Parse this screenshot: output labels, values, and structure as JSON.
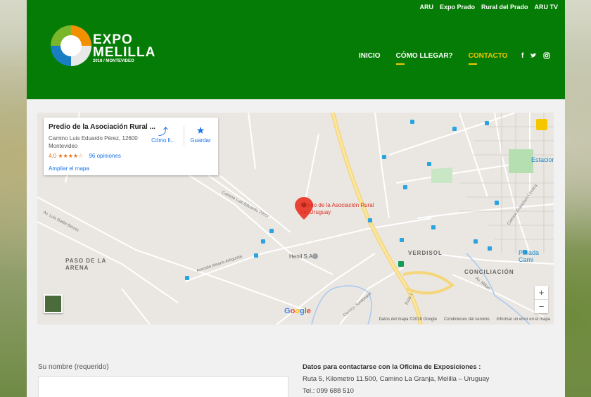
{
  "topnav": [
    "ARU",
    "Expo Prado",
    "Rural del Prado",
    "ARU TV"
  ],
  "logo": {
    "line1": "EXPO",
    "line2": "MELILLA",
    "line3": "2018 / MONTEVIDEO"
  },
  "mainnav": [
    {
      "label": "INICIO",
      "active": false
    },
    {
      "label": "CÓMO LLEGAR?",
      "active": false
    },
    {
      "label": "CONTACTO",
      "active": true
    }
  ],
  "social": [
    "facebook-icon",
    "twitter-icon",
    "instagram-icon"
  ],
  "map": {
    "card": {
      "name": "Predio de la Asociación Rural ...",
      "address": "Camino Luis Eduardo Pérez, 12600 Montevideo",
      "rating": "4.0",
      "stars": "★★★★☆",
      "reviews": "96 opiniones",
      "enlarge": "Ampliar el mapa",
      "directions": "Cómo ll...",
      "save": "Guardar"
    },
    "pin_label": "Predio de la Asociación Rural del Uruguay",
    "places": {
      "henil": "Henil S.A",
      "estacion": "Estacion",
      "parada": "Parada Cami"
    },
    "areas": [
      "PASO DE LA ARENA",
      "VERDISOL",
      "CONCILIACIÓN"
    ],
    "streets": [
      "Camino Luis Eduardo Pérez",
      "Av. Luis Batlle Berres",
      "Avenida Ideario Artiguista",
      "Camino Tomkinson",
      "Camino Francisco Lecocq",
      "Av. Millan",
      "Ruta 1"
    ],
    "footer": [
      "Datos del mapa ©2018 Google",
      "Condiciones del servicio",
      "Informar un error en el mapa"
    ],
    "google": "Google"
  },
  "form": {
    "name_label": "Su nombre (requerido)"
  },
  "contact": {
    "heading": "Datos para contactarse con la Oficina de Exposiciones :",
    "address": "Ruta 5, Kilometro 11.500, Camino La Granja, Melilla – Uruguay",
    "phone": "Tel.: 099 688 510"
  }
}
